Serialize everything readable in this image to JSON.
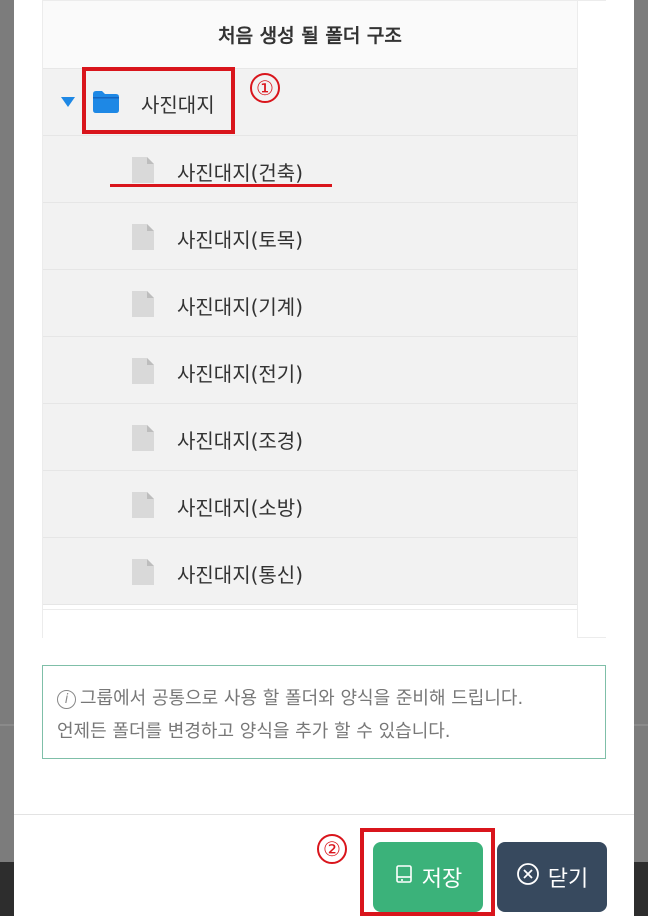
{
  "tree": {
    "header": "처음 생성 될 폴더 구조",
    "root": {
      "label": "사진대지"
    },
    "children": [
      {
        "label": "사진대지(건축)"
      },
      {
        "label": "사진대지(토목)"
      },
      {
        "label": "사진대지(기계)"
      },
      {
        "label": "사진대지(전기)"
      },
      {
        "label": "사진대지(조경)"
      },
      {
        "label": "사진대지(소방)"
      },
      {
        "label": "사진대지(통신)"
      }
    ]
  },
  "notice": {
    "line1": "그룹에서 공통으로 사용 할 폴더와 양식을 준비해 드립니다.",
    "line2": "언제든 폴더를 변경하고 양식을 추가 할 수 있습니다."
  },
  "buttons": {
    "save": "저장",
    "close": "닫기"
  },
  "annotations": {
    "marker1": "①",
    "marker2": "②"
  },
  "colors": {
    "accent_save": "#3bb27a",
    "accent_close": "#37495e",
    "annotation": "#d9151c",
    "folder": "#1e88e5"
  }
}
